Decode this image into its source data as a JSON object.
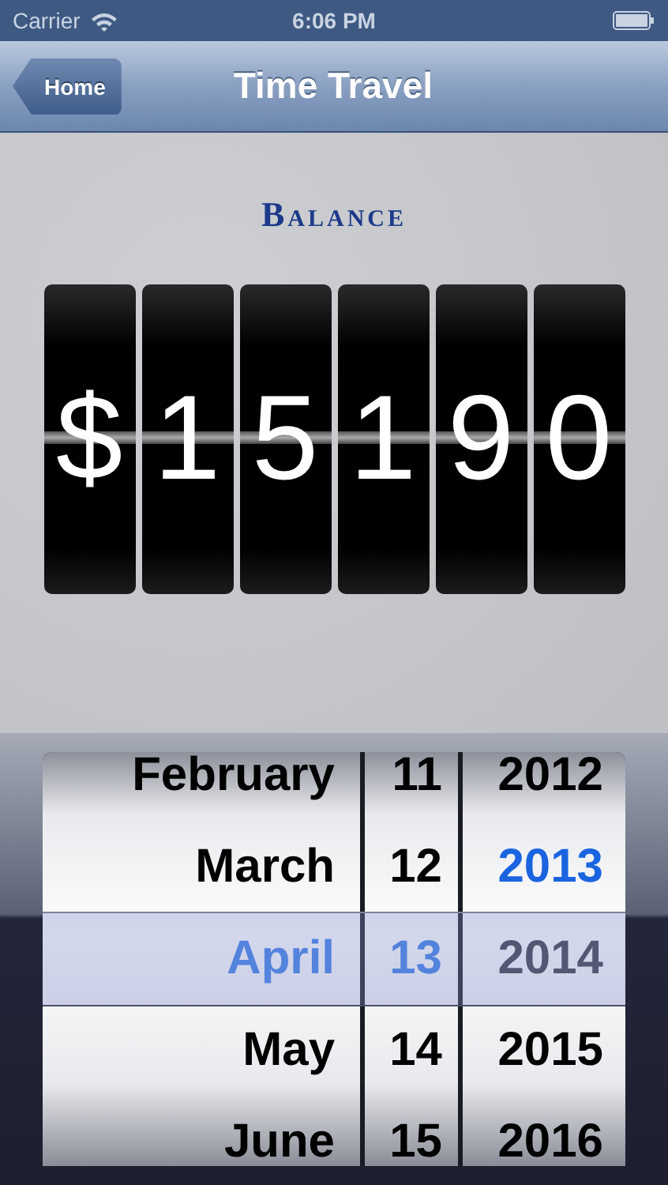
{
  "status_bar": {
    "carrier": "Carrier",
    "time": "6:06 PM"
  },
  "nav_bar": {
    "back_button": "Home",
    "title": "Time Travel"
  },
  "balance": {
    "label": "Balance",
    "digits": [
      "$",
      "1",
      "5",
      "1",
      "9",
      "0"
    ]
  },
  "date_picker": {
    "columns": [
      {
        "kind": "month",
        "items": [
          {
            "label": "February",
            "selected": false,
            "today": false
          },
          {
            "label": "March",
            "selected": false,
            "today": false
          },
          {
            "label": "April",
            "selected": true,
            "today": true
          },
          {
            "label": "May",
            "selected": false,
            "today": false
          },
          {
            "label": "June",
            "selected": false,
            "today": false
          }
        ]
      },
      {
        "kind": "day",
        "items": [
          {
            "label": "11",
            "selected": false,
            "today": false
          },
          {
            "label": "12",
            "selected": false,
            "today": false
          },
          {
            "label": "13",
            "selected": true,
            "today": true
          },
          {
            "label": "14",
            "selected": false,
            "today": false
          },
          {
            "label": "15",
            "selected": false,
            "today": false
          }
        ]
      },
      {
        "kind": "year",
        "items": [
          {
            "label": "2012",
            "selected": false,
            "today": false
          },
          {
            "label": "2013",
            "selected": false,
            "today": true
          },
          {
            "label": "2014",
            "selected": true,
            "today": false
          },
          {
            "label": "2015",
            "selected": false,
            "today": false
          },
          {
            "label": "2016",
            "selected": false,
            "today": false
          }
        ]
      }
    ]
  }
}
